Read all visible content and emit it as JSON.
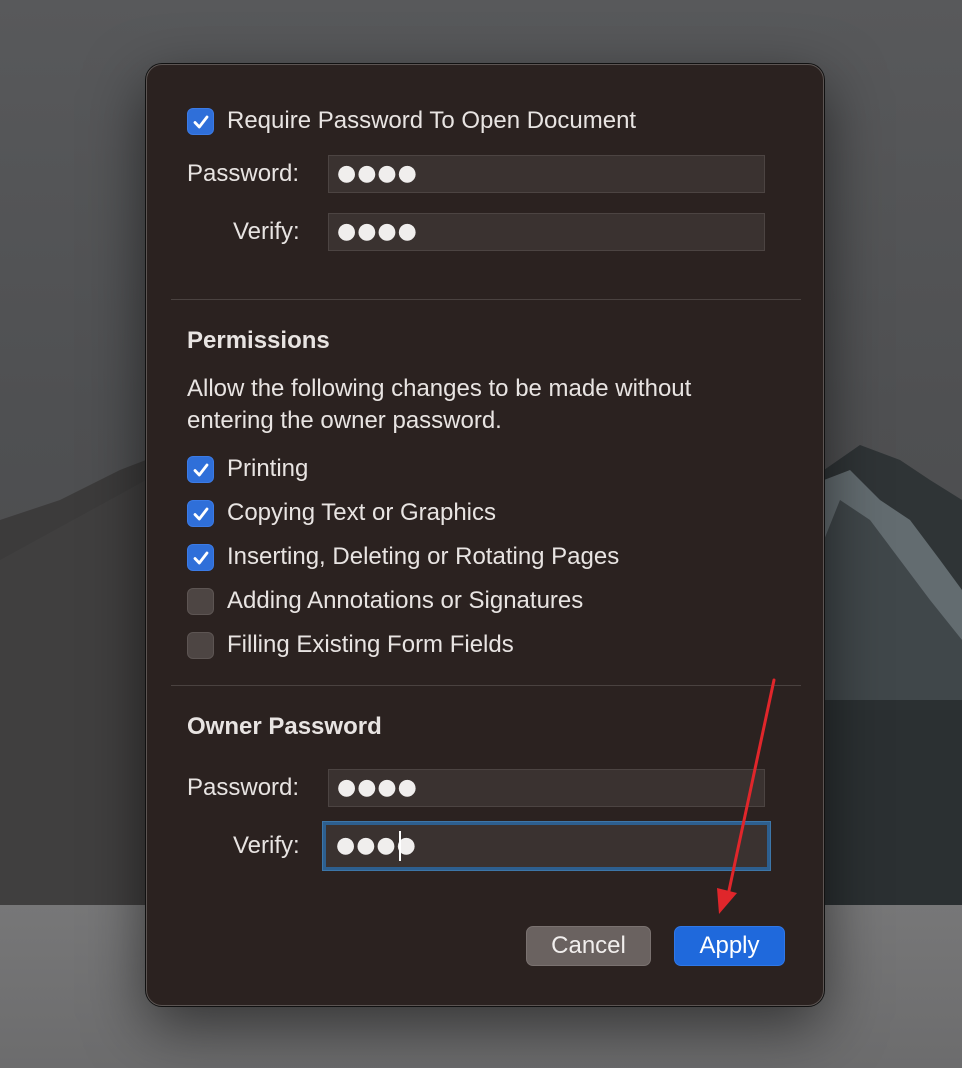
{
  "dialog": {
    "require_password": {
      "label": "Require Password To Open Document",
      "checked": true,
      "password_label": "Password:",
      "password_value": "●●●●",
      "verify_label": "Verify:",
      "verify_value": "●●●●"
    },
    "permissions": {
      "heading": "Permissions",
      "description_line1": "Allow the following changes to be made without",
      "description_line2": "entering the owner password.",
      "items": [
        {
          "label": "Printing",
          "checked": true
        },
        {
          "label": "Copying Text or Graphics",
          "checked": true
        },
        {
          "label": "Inserting, Deleting or Rotating Pages",
          "checked": true
        },
        {
          "label": "Adding Annotations or Signatures",
          "checked": false
        },
        {
          "label": "Filling Existing Form Fields",
          "checked": false
        }
      ]
    },
    "owner_password": {
      "heading": "Owner Password",
      "password_label": "Password:",
      "password_value": "●●●●",
      "verify_label": "Verify:",
      "verify_value": "●●●●"
    },
    "buttons": {
      "cancel": "Cancel",
      "apply": "Apply"
    }
  },
  "colors": {
    "accent": "#1f69dc",
    "checkbox_on": "#2f6fd9",
    "annotation_arrow": "#e0262b"
  }
}
